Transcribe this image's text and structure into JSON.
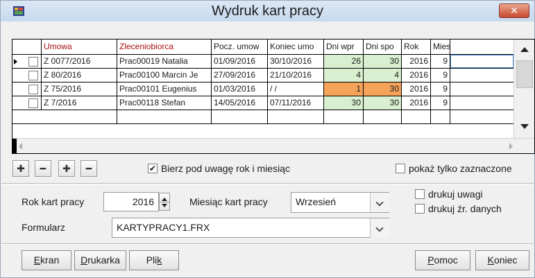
{
  "window": {
    "title": "Wydruk kart pracy",
    "close_label": "✕"
  },
  "grid": {
    "columns": [
      "Umowa",
      "Zleceniobiorca",
      "Pocz. umow",
      "Koniec umo",
      "Dni wpr",
      "Dni spo",
      "Rok",
      "Mies"
    ],
    "rows": [
      {
        "umowa": "Z 0077/2016",
        "zleceniobiorca": "Prac00019 Natalia",
        "pocz": "01/09/2016",
        "koniec": "30/10/2016",
        "dni_wpr": "26",
        "dni_spo": "30",
        "rok": "2016",
        "mies": "9"
      },
      {
        "umowa": "Z 80/2016",
        "zleceniobiorca": "Prac00100 Marcin Je",
        "pocz": "27/09/2016",
        "koniec": "21/10/2016",
        "dni_wpr": "4",
        "dni_spo": "4",
        "rok": "2016",
        "mies": "9"
      },
      {
        "umowa": "Z 75/2016",
        "zleceniobiorca": "Prac00101 Eugenius",
        "pocz": "01/03/2016",
        "koniec": "/ /",
        "dni_wpr": "1",
        "dni_spo": "30",
        "rok": "2016",
        "mies": "9"
      },
      {
        "umowa": "Z 7/2016",
        "zleceniobiorca": "Prac00118 Stefan",
        "pocz": "14/05/2016",
        "koniec": "07/11/2016",
        "dni_wpr": "30",
        "dni_spo": "30",
        "rok": "2016",
        "mies": "9"
      }
    ]
  },
  "toolbar": {
    "add_icon": "plus-icon",
    "remove_icon": "minus-icon",
    "add_all_icon": "plus-all-icon",
    "remove_all_icon": "minus-all-icon",
    "year_month_label": "Bierz pod uwagę rok i miesiąc",
    "year_month_checked": true,
    "only_selected_label": "pokaż tylko zaznaczone",
    "only_selected_checked": false
  },
  "settings": {
    "year_label": "Rok kart pracy",
    "year_value": "2016",
    "month_label": "Miesiąc kart pracy",
    "month_value": "Wrzesień",
    "print_notes_label": "drukuj uwagi",
    "print_source_label": "drukuj źr. danych",
    "form_label": "Formularz",
    "form_value": "KARTYPRACY1.FRX"
  },
  "buttons": {
    "screen": {
      "key": "E",
      "rest": "kran"
    },
    "printer": {
      "key": "D",
      "rest": "rukarka"
    },
    "file": {
      "pre": "Pli",
      "key": "k"
    },
    "help": {
      "key": "P",
      "rest": "omoc"
    },
    "end": {
      "key": "K",
      "rest": "oniec"
    }
  },
  "colors": {
    "green_cell": "#d8f0d0",
    "orange_cell": "#f5a25a",
    "header_red": "#a81010",
    "close_red": "#c8482d"
  }
}
